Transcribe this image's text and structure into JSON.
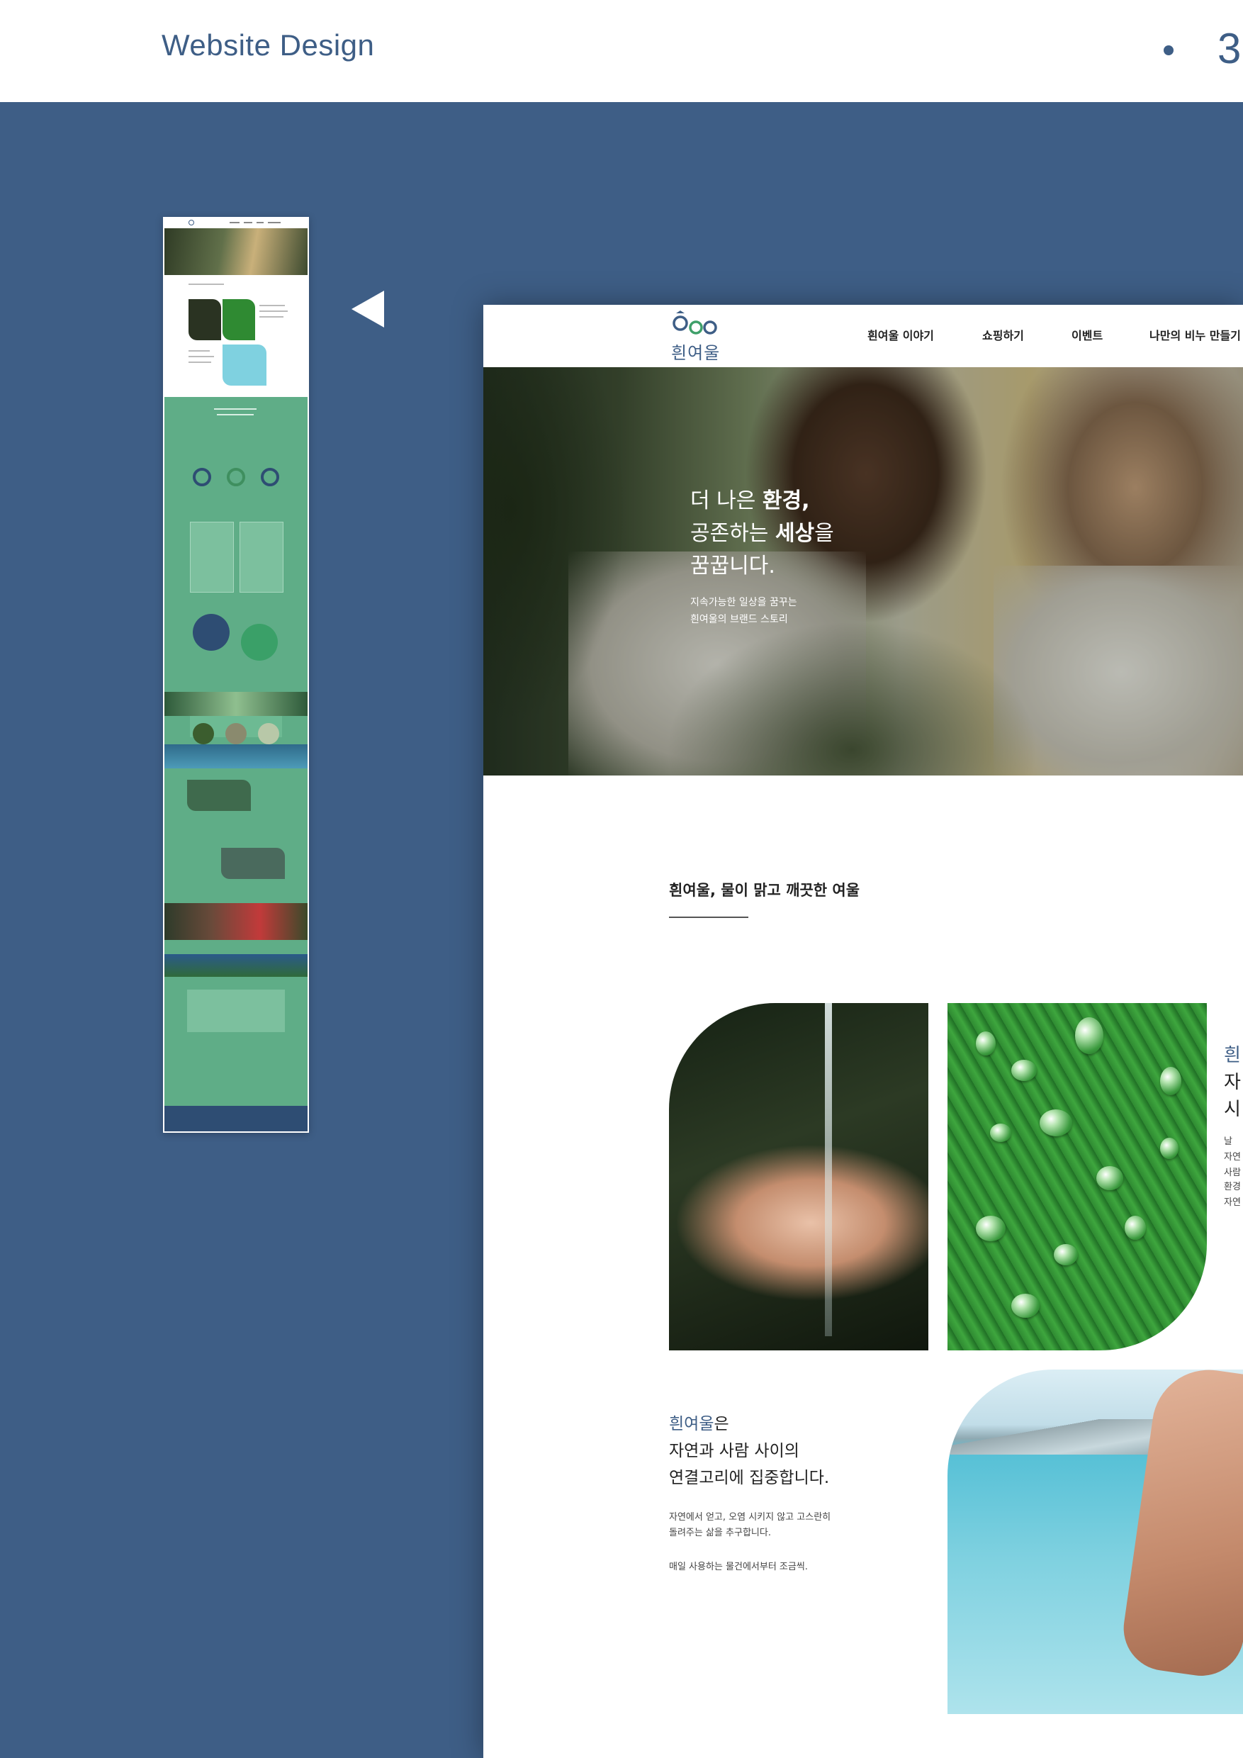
{
  "header": {
    "title": "Website Design",
    "page_number": "3"
  },
  "site": {
    "brand": "흰여울",
    "nav": [
      "흰여울 이야기",
      "쇼핑하기",
      "이벤트",
      "나만의 비누 만들기"
    ],
    "hero": {
      "line1_a": "더 나은 ",
      "line1_b": "환경,",
      "line2_a": "공존하는 ",
      "line2_b": "세상",
      "line2_c": "을",
      "line3": "꿈꿉니다.",
      "sub1": "지속가능한 일상을 꿈꾸는",
      "sub2": "흰여울의 브랜드 스토리"
    },
    "intro_title": "흰여울, 물이 맑고 깨끗한 여울",
    "side": {
      "l1": "흰",
      "l2": "자",
      "l3": "시",
      "b1": "날",
      "b2": "자연",
      "b3": "사람",
      "c1": "환경",
      "c2": "자연"
    },
    "story": {
      "brand_word": "흰여울",
      "brand_suffix": "은",
      "line2": "자연과 사람 사이의",
      "line3": "연결고리에 집중합니다.",
      "p1_line1": "자연에서 얻고, 오염 시키지 않고 고스란히",
      "p1_line2": "돌려주는 삶을 추구합니다.",
      "p2": "매일 사용하는 물건에서부터 조금씩."
    }
  },
  "colors": {
    "brand_blue": "#3e5e86",
    "thumb_green": "#5fad87",
    "white": "#ffffff"
  }
}
